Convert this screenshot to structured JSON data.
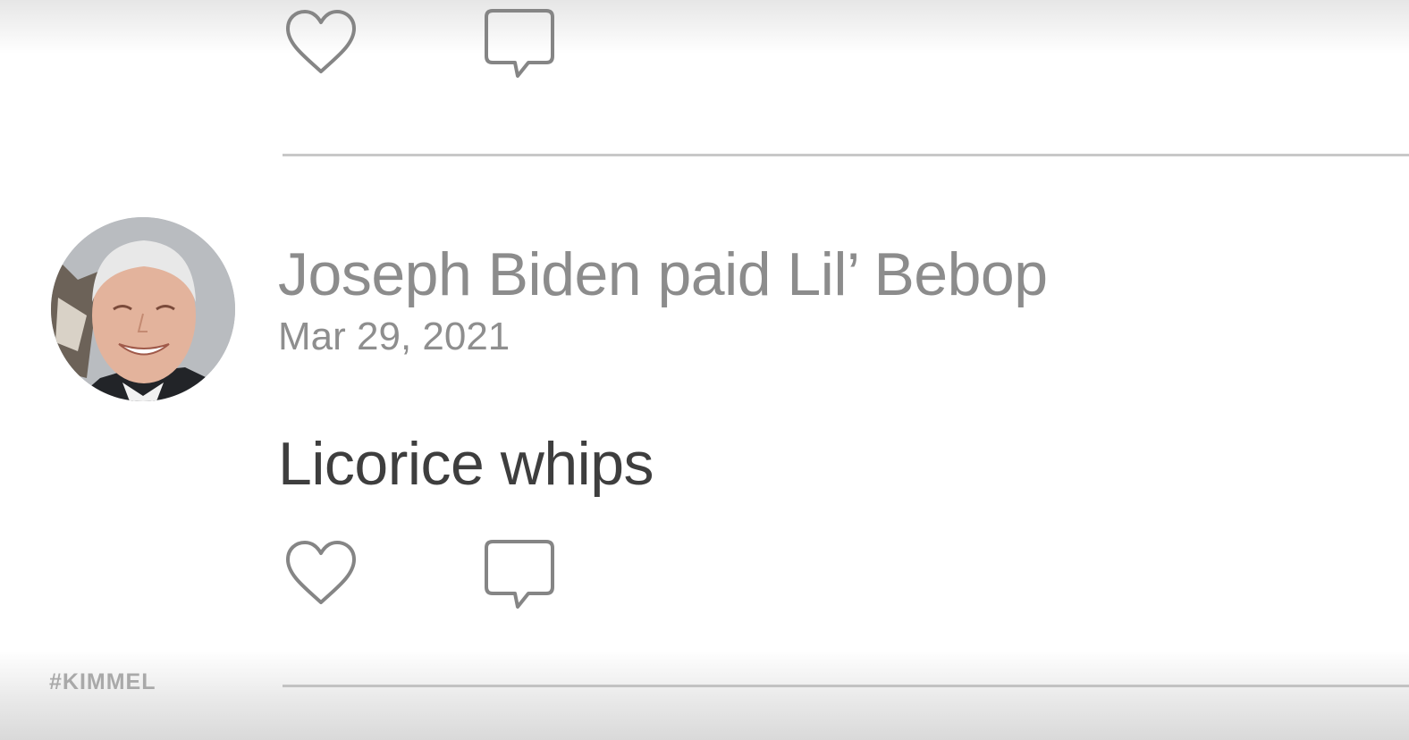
{
  "feed": {
    "previous_post": {
      "actions": {
        "like_icon": "heart-icon",
        "comment_icon": "comment-icon"
      }
    },
    "post": {
      "author_line": "Joseph Biden paid Lil’ Bebop",
      "date": "Mar 29, 2021",
      "message": "Licorice whips",
      "actions": {
        "like_icon": "heart-icon",
        "comment_icon": "comment-icon"
      }
    }
  },
  "watermark": "#KIMMEL",
  "colors": {
    "background": "#ffffff",
    "author_text": "#8c8c8c",
    "message_text": "#3e3e3e",
    "icon_stroke": "#858585",
    "divider": "#c8c8c8"
  }
}
